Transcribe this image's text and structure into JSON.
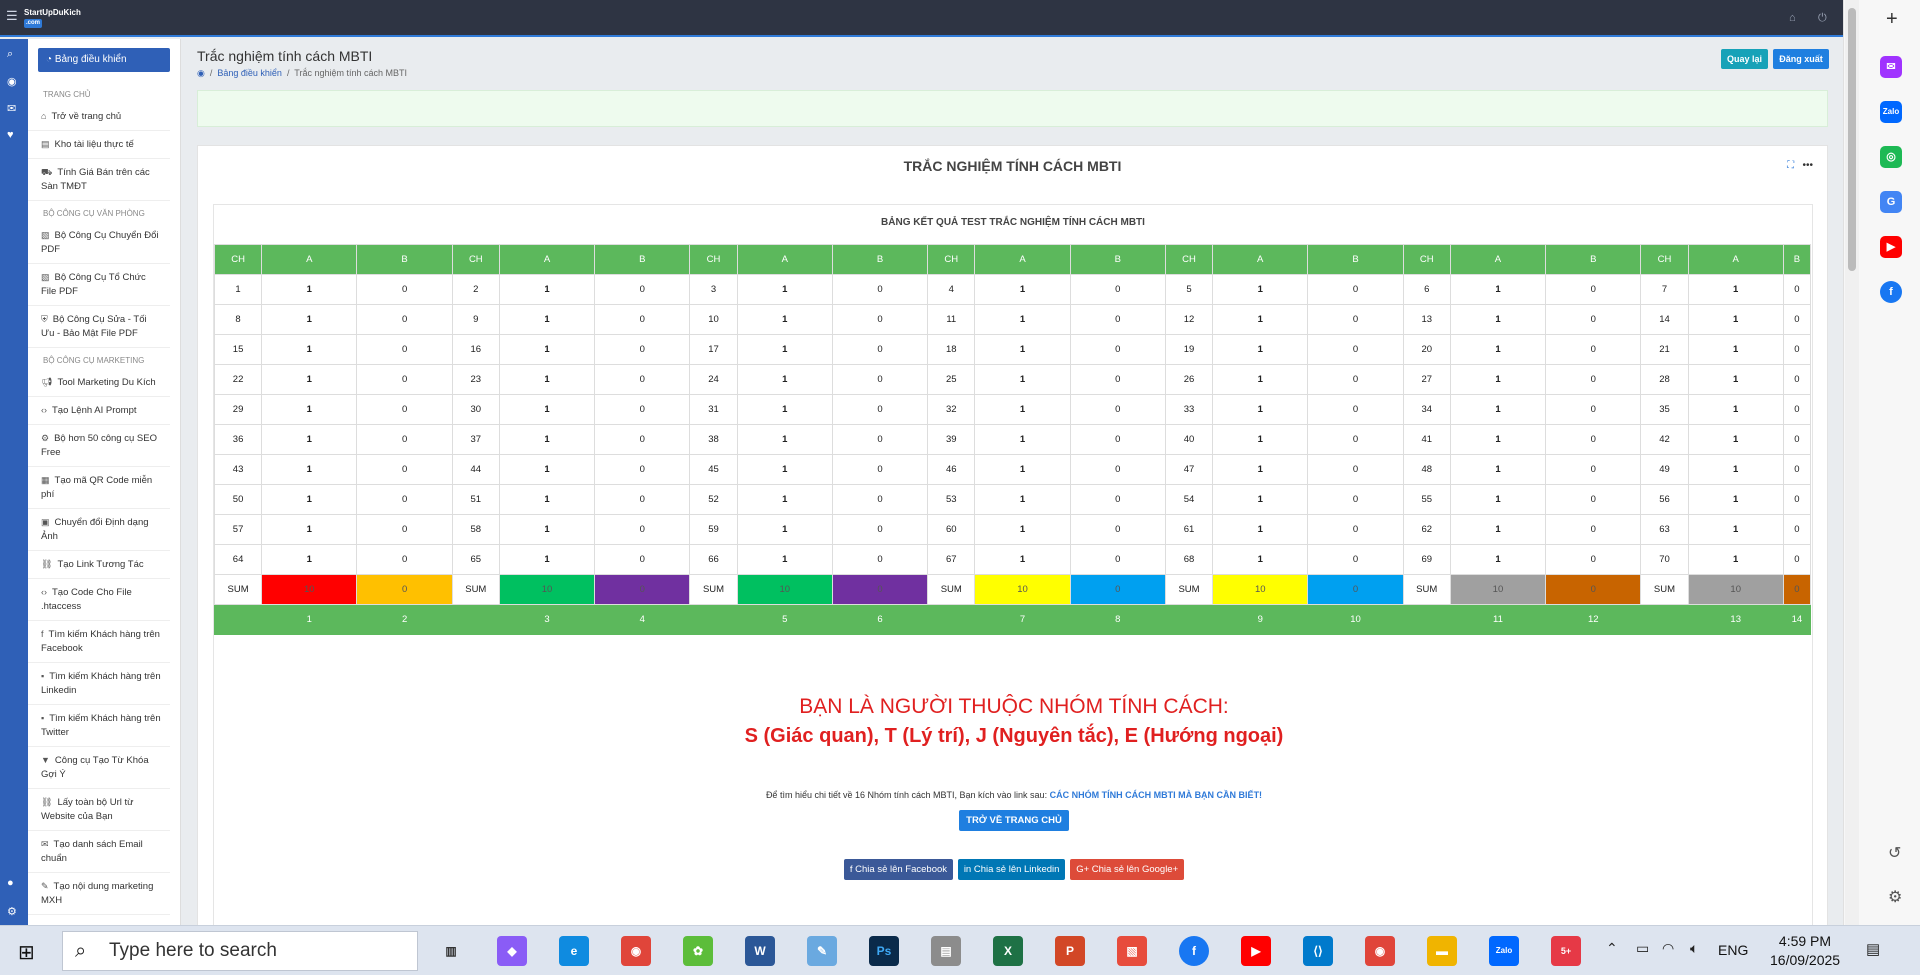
{
  "topbar": {
    "logo_text": "StartUpDuKich",
    "logo_tag": ".com"
  },
  "sidebar": {
    "dashboard": "Bảng điều khiển",
    "sections": [
      {
        "title": "TRANG CHỦ",
        "items": [
          {
            "label": "Trở về trang chủ",
            "icon": "home-icon"
          },
          {
            "label": "Kho tài liệu thực tế",
            "icon": "file-icon"
          },
          {
            "label": "Tính Giá Bán trên các Sàn TMĐT",
            "icon": "cart-icon"
          }
        ]
      },
      {
        "title": "BỘ CÔNG CỤ VĂN PHÒNG",
        "items": [
          {
            "label": "Bộ Công Cụ Chuyển Đổi PDF",
            "icon": "pdf-icon"
          },
          {
            "label": "Bộ Công Cụ Tổ Chức File PDF",
            "icon": "pdf-icon"
          },
          {
            "label": "Bộ Công Cụ Sửa - Tối Ưu - Bảo Mật File PDF",
            "icon": "shield-icon"
          }
        ]
      },
      {
        "title": "BỘ CÔNG CỤ MARKETING",
        "items": [
          {
            "label": "Tool Marketing Du Kích",
            "icon": "megaphone-icon"
          },
          {
            "label": "Tạo Lệnh AI Prompt",
            "icon": "code-icon"
          },
          {
            "label": "Bộ hơn 50 công cụ SEO Free",
            "icon": "gear-icon"
          },
          {
            "label": "Tạo mã QR Code miễn phí",
            "icon": "qr-icon"
          },
          {
            "label": "Chuyển đổi Định dạng Ảnh",
            "icon": "image-icon"
          },
          {
            "label": "Tạo Link Tương Tác",
            "icon": "link-icon"
          },
          {
            "label": "Tạo Code Cho File .htaccess",
            "icon": "code-icon"
          },
          {
            "label": "Tìm kiếm Khách hàng trên Facebook",
            "icon": "facebook-icon"
          },
          {
            "label": "Tìm kiếm Khách hàng trên Linkedin",
            "icon": "linkedin-icon"
          },
          {
            "label": "Tìm kiếm Khách hàng trên Twitter",
            "icon": "twitter-icon"
          },
          {
            "label": "Công cụ Tạo Từ Khóa Gợi Ý",
            "icon": "filter-icon"
          },
          {
            "label": "Lấy toàn bộ Url từ Website của Bạn",
            "icon": "link-icon"
          },
          {
            "label": "Tạo danh sách Email chuẩn",
            "icon": "email-icon"
          },
          {
            "label": "Tạo nội dung marketing MXH",
            "icon": "edit-icon"
          }
        ]
      }
    ]
  },
  "header": {
    "title": "Trắc nghiệm tính cách MBTI",
    "breadcrumb_home": "Bảng điều khiển",
    "breadcrumb_current": "Trắc nghiệm tính cách MBTI",
    "back_button": "Quay lại",
    "logout_button": "Đăng xuất"
  },
  "card": {
    "title": "TRẮC NGHIỆM TÍNH CÁCH MBTI",
    "table_caption": "BẢNG KẾT QUẢ TEST TRẮC NGHIỆM TÍNH CÁCH MBTI",
    "groups": 7,
    "col_labels": [
      "CH",
      "A",
      "B"
    ],
    "sum_label": "SUM",
    "rows": [
      [
        1,
        2,
        3,
        4,
        5,
        6,
        7
      ],
      [
        8,
        9,
        10,
        11,
        12,
        13,
        14
      ],
      [
        15,
        16,
        17,
        18,
        19,
        20,
        21
      ],
      [
        22,
        23,
        24,
        25,
        26,
        27,
        28
      ],
      [
        29,
        30,
        31,
        32,
        33,
        34,
        35
      ],
      [
        36,
        37,
        38,
        39,
        40,
        41,
        42
      ],
      [
        43,
        44,
        45,
        46,
        47,
        48,
        49
      ],
      [
        50,
        51,
        52,
        53,
        54,
        55,
        56
      ],
      [
        57,
        58,
        59,
        60,
        61,
        62,
        63
      ],
      [
        64,
        65,
        66,
        67,
        68,
        69,
        70
      ]
    ],
    "a_value": "1",
    "b_value": "0",
    "sums": [
      {
        "a": "10",
        "b": "0",
        "a_color": "#ff0000",
        "b_color": "#ffc000"
      },
      {
        "a": "10",
        "b": "0",
        "a_color": "#00c060",
        "b_color": "#7030a0"
      },
      {
        "a": "10",
        "b": "0",
        "a_color": "#00c060",
        "b_color": "#7030a0"
      },
      {
        "a": "10",
        "b": "0",
        "a_color": "#ffff00",
        "b_color": "#00a0f0"
      },
      {
        "a": "10",
        "b": "0",
        "a_color": "#ffff00",
        "b_color": "#00a0f0"
      },
      {
        "a": "10",
        "b": "0",
        "a_color": "#a0a0a0",
        "b_color": "#c86400"
      },
      {
        "a": "10",
        "b": "0",
        "a_color": "#a0a0a0",
        "b_color": "#c86400"
      }
    ],
    "footer_numbers": [
      "1",
      "2",
      "3",
      "4",
      "5",
      "6",
      "7",
      "8",
      "9",
      "10",
      "11",
      "12",
      "13",
      "14"
    ],
    "result_line1": "BẠN LÀ NGƯỜI THUỘC NHÓM TÍNH CÁCH:",
    "result_line2": "S (Giác quan), T (Lý trí), J (Nguyên tắc), E (Hướng ngoại)",
    "info_text": "Để tìm hiểu chi tiết về 16 Nhóm tính cách MBTI, Bạn kích vào link sau: ",
    "info_link": "CÁC NHÓM TÍNH CÁCH MBTI MÀ BẠN CẦN BIẾT!",
    "home_button": "TRỞ VỀ TRANG CHỦ",
    "share_facebook": "Chia sẻ lên Facebook",
    "share_linkedin": "Chia sẻ lên Linkedin",
    "share_google": "Chia sẻ lên Google+"
  },
  "taskbar": {
    "search_placeholder": "Type here to search",
    "lang": "ENG",
    "time": "4:59 PM",
    "date": "16/09/2025"
  }
}
